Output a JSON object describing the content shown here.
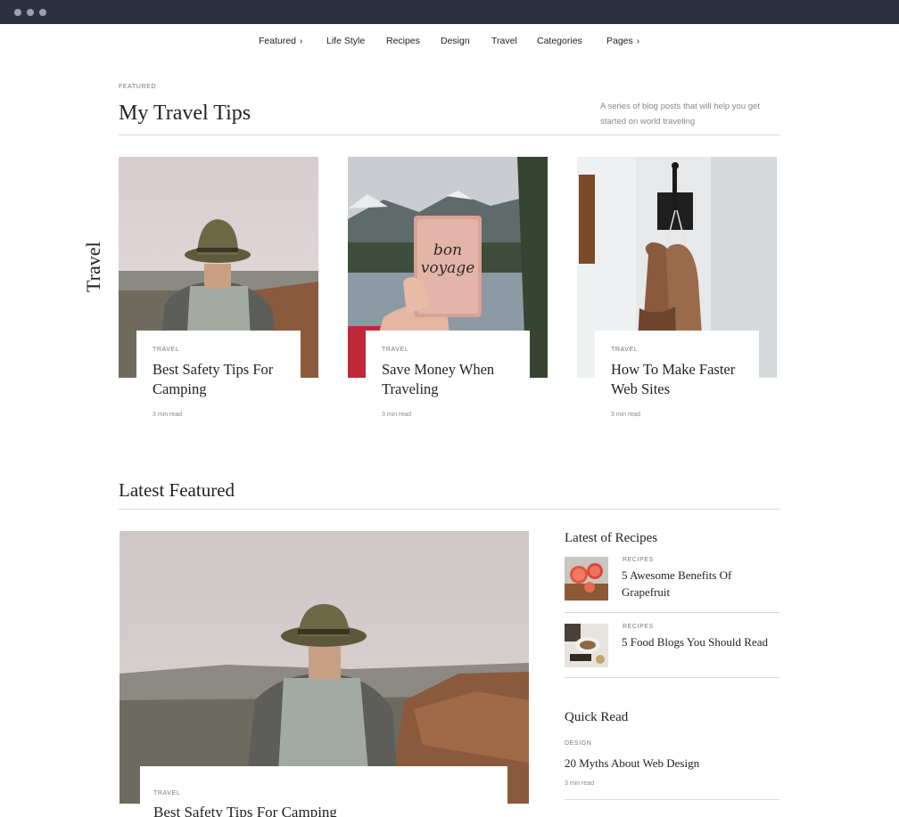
{
  "nav": {
    "items": [
      {
        "label": "Featured",
        "has_chevron": true
      },
      {
        "label": "Life Style",
        "has_chevron": false
      },
      {
        "label": "Recipes",
        "has_chevron": false
      },
      {
        "label": "Design",
        "has_chevron": false
      },
      {
        "label": "Travel",
        "has_chevron": false
      },
      {
        "label": "Categories",
        "has_chevron": false
      },
      {
        "label": "Pages",
        "has_chevron": true
      }
    ],
    "chevron": "›"
  },
  "travel_section": {
    "kicker": "FEATURED",
    "title": "My Travel Tips",
    "description": "A series of blog posts that will help you get started on world traveling",
    "vertical_label": "Travel",
    "cards": [
      {
        "category": "TRAVEL",
        "title": "Best Safety Tips For Camping",
        "read_time": "3 min read"
      },
      {
        "category": "TRAVEL",
        "title": "Save Money When Traveling",
        "read_time": "3 min read"
      },
      {
        "category": "TRAVEL",
        "title": "How To Make Faster Web Sites",
        "read_time": "3 min read"
      }
    ]
  },
  "latest_featured": {
    "title": "Latest Featured",
    "main_post": {
      "category": "TRAVEL",
      "title": "Best Safety Tips For Camping"
    }
  },
  "sidebar": {
    "recipes_heading": "Latest of Recipes",
    "recipes": [
      {
        "category": "RECIPES",
        "title": "5 Awesome Benefits Of Grapefruit"
      },
      {
        "category": "RECIPES",
        "title": "5 Food Blogs You Should Read"
      }
    ],
    "quick_read_heading": "Quick Read",
    "quick_read": {
      "category": "DESIGN",
      "title": "20 Myths About Web Design",
      "read_time": "3 min read"
    }
  },
  "images": {
    "card_1": "hiker-with-hat-photo",
    "card_2": "bon-voyage-passport-photo",
    "card_3": "boxing-gloves-on-hook-photo",
    "main_post": "hiker-canyon-photo",
    "recipe_1": "grapefruit-photo",
    "recipe_2": "food-table-photo",
    "passport_text": "bon voyage"
  }
}
